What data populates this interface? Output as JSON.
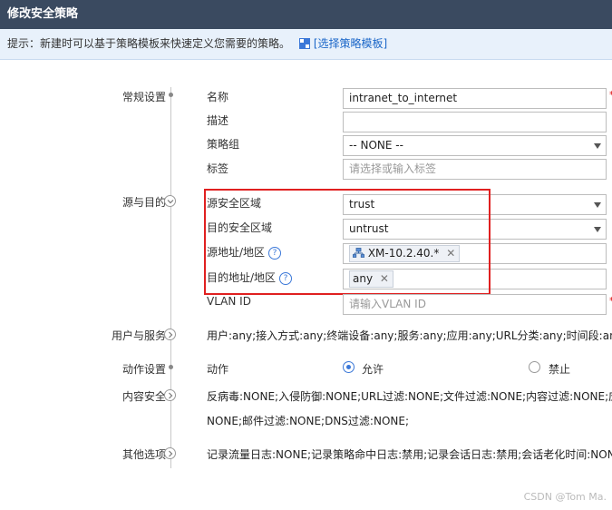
{
  "title": "修改安全策略",
  "hint": {
    "text": "提示：新建时可以基于策略模板来快速定义您需要的策略。",
    "link": "[选择策略模板]"
  },
  "sections": {
    "general": "常规设置",
    "src_dst": "源与目的",
    "user_service": "用户与服务",
    "action": "动作设置",
    "content": "内容安全",
    "other": "其他选项"
  },
  "fields": {
    "name": {
      "label": "名称",
      "value": "intranet_to_internet",
      "required": "*"
    },
    "desc": {
      "label": "描述",
      "value": ""
    },
    "group": {
      "label": "策略组",
      "value": "-- NONE --"
    },
    "tag": {
      "label": "标签",
      "placeholder": "请选择或输入标签"
    },
    "src_zone": {
      "label": "源安全区域",
      "value": "trust"
    },
    "dst_zone": {
      "label": "目的安全区域",
      "value": "untrust"
    },
    "src_addr": {
      "label": "源地址/地区",
      "tag": "XM-10.2.40.*"
    },
    "dst_addr": {
      "label": "目的地址/地区",
      "tag": "any"
    },
    "vlan": {
      "label": "VLAN ID",
      "placeholder": "请输入VLAN ID",
      "required": "*"
    }
  },
  "user_service_summary": "用户:any;接入方式:any;终端设备:any;服务:any;应用:any;URL分类:any;时间段:any;",
  "action": {
    "label": "动作",
    "permit": "允许",
    "deny": "禁止",
    "selected": "permit"
  },
  "content_summary_line1": "反病毒:NONE;入侵防御:NONE;URL过滤:NONE;文件过滤:NONE;内容过滤:NONE;应",
  "content_summary_line2": "NONE;邮件过滤:NONE;DNS过滤:NONE;",
  "other_summary": "记录流量日志:NONE;记录策略命中日志:禁用;记录会话日志:禁用;会话老化时间:NONE",
  "watermark": "CSDN @Tom Ma.",
  "colors": {
    "titlebar": "#3a4a60",
    "hintbg": "#e8f1fb",
    "highlight": "#e02020",
    "accent": "#3b78d8"
  }
}
